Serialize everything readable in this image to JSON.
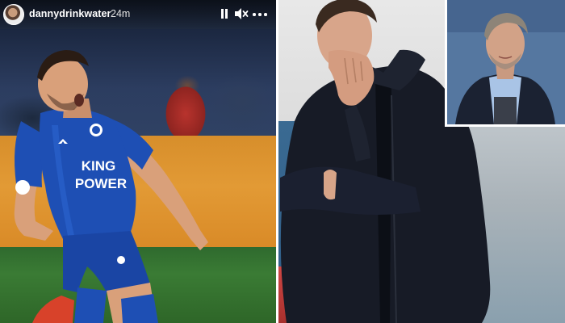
{
  "story": {
    "username": "dannydrinkwater",
    "timestamp": "24m",
    "controls": {
      "pause_icon": "pause-icon",
      "mute_icon": "speaker-muted-icon",
      "more_icon": "ellipsis-icon"
    },
    "shirt_sponsor": [
      "KING",
      "POWER"
    ],
    "colors": {
      "kit_blue": "#1e4fb4",
      "ad_board_orange": "#e29a35",
      "pitch_green": "#3a7b34"
    }
  }
}
